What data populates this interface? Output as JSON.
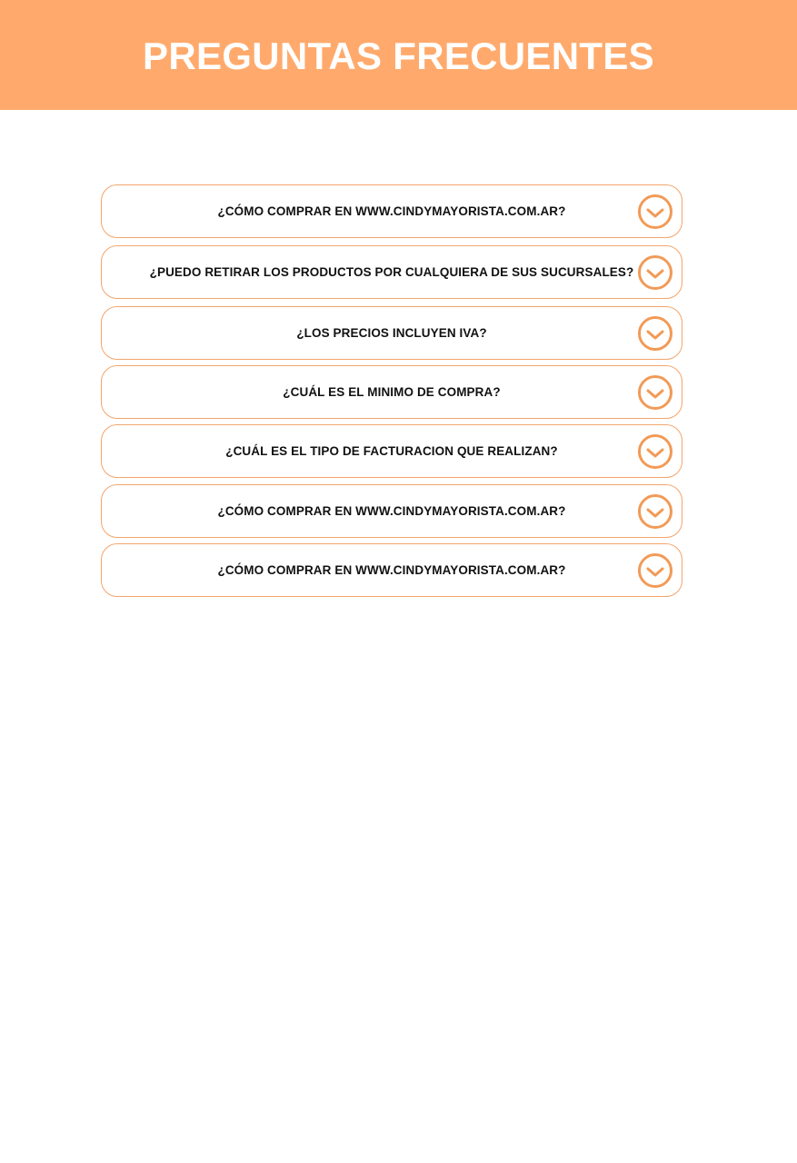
{
  "header": {
    "title": "PREGUNTAS FRECUENTES"
  },
  "faq": {
    "items": [
      {
        "question": "¿CÓMO COMPRAR EN WWW.CINDYMAYORISTA.COM.AR?"
      },
      {
        "question": "¿PUEDO RETIRAR LOS PRODUCTOS POR CUALQUIERA DE SUS SUCURSALES?"
      },
      {
        "question": "¿LOS PRECIOS INCLUYEN IVA?"
      },
      {
        "question": "¿CUÁL ES EL MINIMO DE COMPRA?"
      },
      {
        "question": "¿CUÁL ES EL TIPO DE FACTURACION QUE REALIZAN?"
      },
      {
        "question": "¿CÓMO COMPRAR EN WWW.CINDYMAYORISTA.COM.AR?"
      },
      {
        "question": "¿CÓMO COMPRAR EN WWW.CINDYMAYORISTA.COM.AR?"
      }
    ],
    "toggle_icon": "chevron-down-circle-icon"
  },
  "colors": {
    "header_bg": "#ffaa6c",
    "accent": "#f29a56",
    "border": "#f4a56c",
    "text": "#111111"
  }
}
